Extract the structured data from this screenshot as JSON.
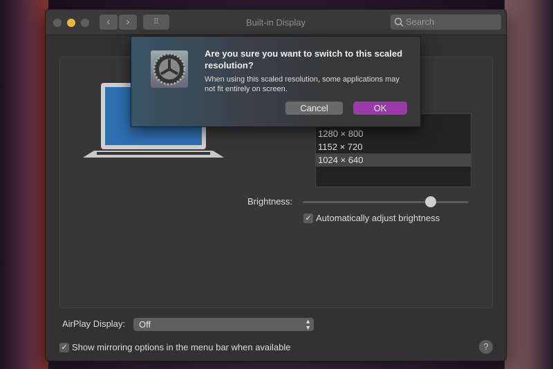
{
  "window": {
    "title": "Built-in Display",
    "search_placeholder": "Search",
    "back_label": "‹",
    "forward_label": "›",
    "grid_label": "⠿"
  },
  "resolutions": {
    "items": [
      "1280 × 800",
      "1152 × 720",
      "1024 × 640"
    ],
    "selected": "1024 × 640"
  },
  "brightness": {
    "label": "Brightness:",
    "value": 0.77,
    "auto_label": "Automatically adjust brightness",
    "auto_checked": true
  },
  "airplay": {
    "label": "AirPlay Display:",
    "value": "Off"
  },
  "mirroring": {
    "label": "Show mirroring options in the menu bar when available",
    "checked": true
  },
  "help_label": "?",
  "dialog": {
    "title": "Are you sure you want to switch to this scaled resolution?",
    "message": "When using this scaled resolution, some applications may not fit entirely on screen.",
    "cancel": "Cancel",
    "ok": "OK"
  },
  "colors": {
    "ok_button": "#9a3aa8",
    "minimize": "#f0b830"
  }
}
